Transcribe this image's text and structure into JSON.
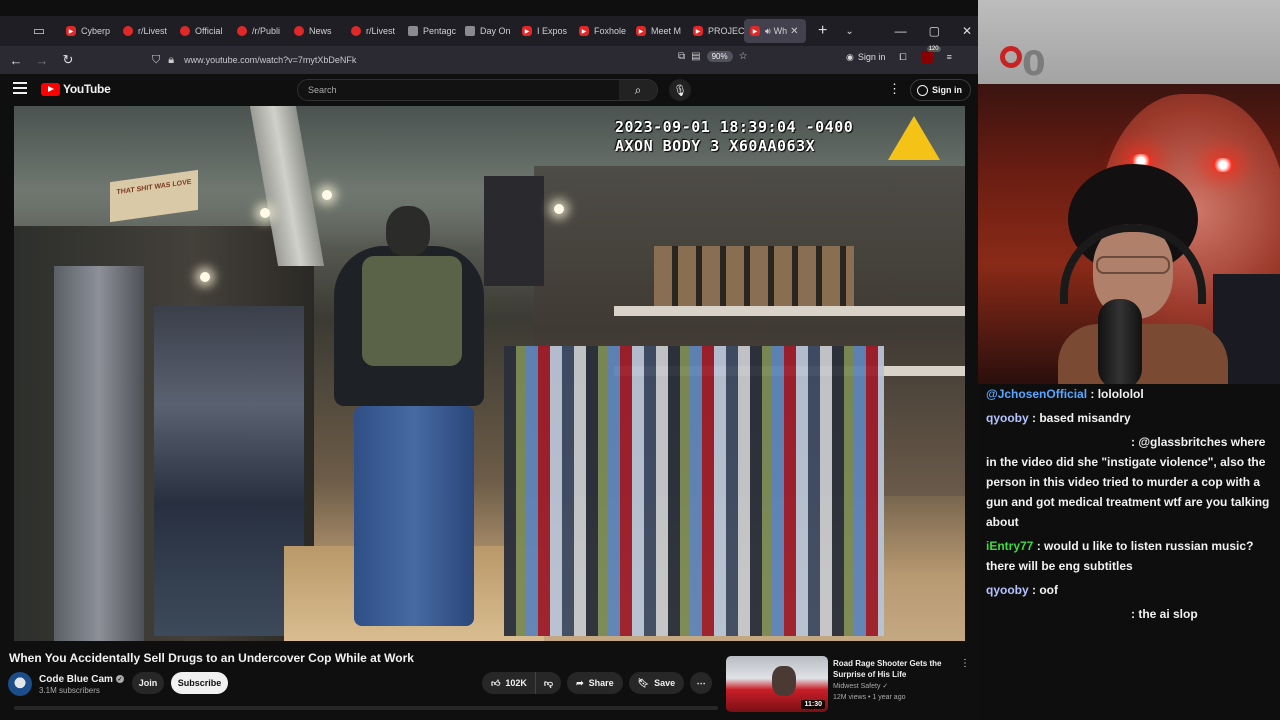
{
  "browser": {
    "tabs": [
      {
        "label": "Cyberp",
        "favicon": "youtube-icon"
      },
      {
        "label": "r/Livest",
        "favicon": "reddit-icon"
      },
      {
        "label": "Official",
        "favicon": "reddit-icon"
      },
      {
        "label": "/r/Publi",
        "favicon": "reddit-icon"
      },
      {
        "label": "News",
        "favicon": "reddit-icon"
      },
      {
        "label": "r/Livest",
        "favicon": "reddit-icon"
      },
      {
        "label": "Pentagc",
        "favicon": "page-icon"
      },
      {
        "label": "Day On",
        "favicon": "page-icon"
      },
      {
        "label": "I Expos",
        "favicon": "youtube-icon"
      },
      {
        "label": "Foxhole",
        "favicon": "youtube-icon"
      },
      {
        "label": "Meet M",
        "favicon": "youtube-icon"
      },
      {
        "label": "PROJEC",
        "favicon": "youtube-icon"
      },
      {
        "label": "Wh",
        "favicon": "youtube-icon",
        "active": true
      }
    ],
    "url": "www.youtube.com/watch?v=7mytXbDeNFk",
    "zoom": "90%",
    "signin_label": "Sign in",
    "ublock_count": "120"
  },
  "youtube": {
    "logo_text": "YouTube",
    "search_placeholder": "Search",
    "signin_label": "Sign in",
    "video_overlay": {
      "timestamp": "2023-09-01 18:39:04 -0400",
      "device": "AXON BODY 3 X60AA063X",
      "store_sign": "THAT SHIT WAS LOVE"
    },
    "video_title": "When You Accidentally Sell Drugs to an Undercover Cop While at Work",
    "channel": {
      "name": "Code Blue Cam",
      "subscribers": "3.1M subscribers"
    },
    "join_label": "Join",
    "subscribe_label": "Subscribe",
    "likes": "102K",
    "share_label": "Share",
    "save_label": "Save",
    "recommendation": {
      "title": "Road Rage Shooter Gets the Surprise of His Life",
      "channel": "Midwest Safety",
      "meta": "12M views • 1 year ago",
      "duration": "11:30"
    }
  },
  "stream": {
    "counter": "0",
    "chat": [
      {
        "user": "@JchosenOfficial",
        "text": " : lolololol",
        "color": "blue"
      },
      {
        "user": "qyooby",
        "text": " : based misandry",
        "color": "lavender"
      },
      {
        "user": "",
        "text": ": @glassbritches where in the video did she \"instigate violence\", also the person in this video tried to murder a cop with a gun and got medical treatment wtf are you talking about",
        "color": "hidden"
      },
      {
        "user": "iEntry77",
        "text": " : would u like to listen russian music? there will be eng subtitles",
        "color": "green"
      },
      {
        "user": "qyooby",
        "text": " : oof",
        "color": "lavender"
      },
      {
        "user": "",
        "text": ": the ai slop",
        "color": "hidden"
      }
    ]
  }
}
